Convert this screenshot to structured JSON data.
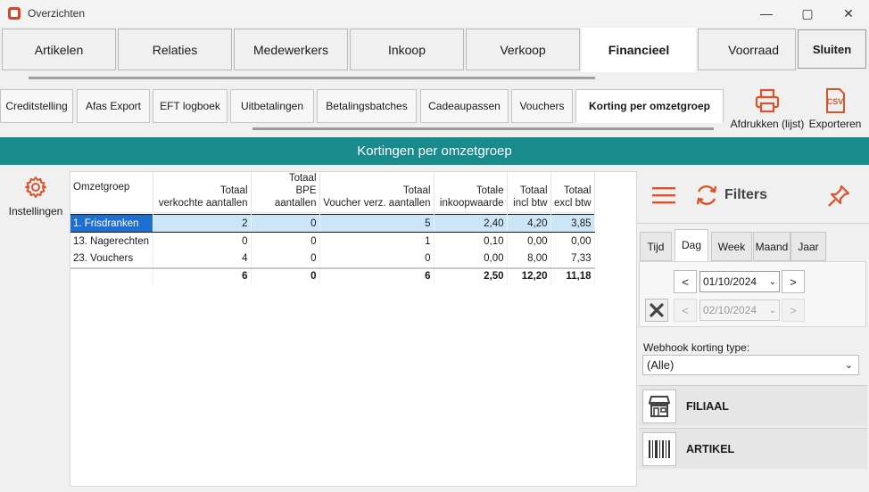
{
  "window": {
    "title": "Overzichten",
    "minimize": "—",
    "maximize": "▢",
    "close": "✕"
  },
  "main_tabs": [
    "Artikelen",
    "Relaties",
    "Medewerkers",
    "Inkoop",
    "Verkoop",
    "Financieel",
    "Voorraad"
  ],
  "active_main_tab": "Financieel",
  "sluiten_label": "Sluiten",
  "sub_tabs": [
    "Creditstelling",
    "Afas Export",
    "EFT logboek",
    "Uitbetalingen",
    "Betalingsbatches",
    "Cadeaupassen",
    "Vouchers",
    "Korting per omzetgroep"
  ],
  "active_sub_tab": "Korting per omzetgroep",
  "toolbar": {
    "print_label": "Afdrukken (lijst)",
    "export_label": "Exporteren",
    "csv_text": "CSV"
  },
  "header_title": "Kortingen per omzetgroep",
  "settings_label": "Instellingen",
  "table": {
    "columns": [
      "Omzetgroep",
      "Totaal\nverkochte aantallen",
      "Totaal\nBPE aantallen",
      "Totaal\nVoucher verz. aantallen",
      "Totale\ninkoopwaarde",
      "Totaal\nincl btw",
      "Totaal\nexcl btw"
    ],
    "rows": [
      [
        "1. Frisdranken",
        "2",
        "0",
        "5",
        "2,40",
        "4,20",
        "3,85"
      ],
      [
        "13. Nagerechten",
        "0",
        "0",
        "1",
        "0,10",
        "0,00",
        "0,00"
      ],
      [
        "23. Vouchers",
        "4",
        "0",
        "0",
        "0,00",
        "8,00",
        "7,33"
      ]
    ],
    "selected_row": 0,
    "totals": [
      "",
      "6",
      "0",
      "6",
      "2,50",
      "12,20",
      "11,18"
    ]
  },
  "filters": {
    "title": "Filters",
    "period_tabs": [
      "Tijd",
      "Dag",
      "Week",
      "Maand",
      "Jaar"
    ],
    "active_period": "Dag",
    "date_from": "01/10/2024",
    "date_to": "02/10/2024",
    "prev": "<",
    "next": ">",
    "webhook_label": "Webhook korting type:",
    "webhook_value": "(Alle)",
    "groups": [
      "FILIAAL",
      "ARTIKEL"
    ]
  },
  "colors": {
    "accent_teal": "#1a8b8d",
    "icon_orange": "#d9542b",
    "selection_blue": "#1e6fd0",
    "selection_light": "#cde6f7"
  }
}
